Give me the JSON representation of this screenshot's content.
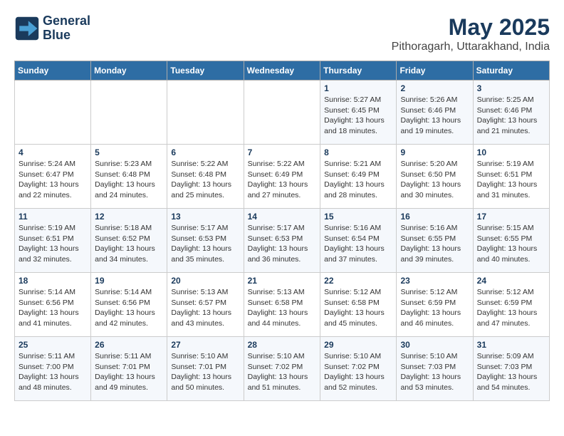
{
  "header": {
    "logo_line1": "General",
    "logo_line2": "Blue",
    "month_year": "May 2025",
    "location": "Pithoragarh, Uttarakhand, India"
  },
  "weekdays": [
    "Sunday",
    "Monday",
    "Tuesday",
    "Wednesday",
    "Thursday",
    "Friday",
    "Saturday"
  ],
  "weeks": [
    [
      {
        "day": "",
        "info": ""
      },
      {
        "day": "",
        "info": ""
      },
      {
        "day": "",
        "info": ""
      },
      {
        "day": "",
        "info": ""
      },
      {
        "day": "1",
        "info": "Sunrise: 5:27 AM\nSunset: 6:45 PM\nDaylight: 13 hours\nand 18 minutes."
      },
      {
        "day": "2",
        "info": "Sunrise: 5:26 AM\nSunset: 6:46 PM\nDaylight: 13 hours\nand 19 minutes."
      },
      {
        "day": "3",
        "info": "Sunrise: 5:25 AM\nSunset: 6:46 PM\nDaylight: 13 hours\nand 21 minutes."
      }
    ],
    [
      {
        "day": "4",
        "info": "Sunrise: 5:24 AM\nSunset: 6:47 PM\nDaylight: 13 hours\nand 22 minutes."
      },
      {
        "day": "5",
        "info": "Sunrise: 5:23 AM\nSunset: 6:48 PM\nDaylight: 13 hours\nand 24 minutes."
      },
      {
        "day": "6",
        "info": "Sunrise: 5:22 AM\nSunset: 6:48 PM\nDaylight: 13 hours\nand 25 minutes."
      },
      {
        "day": "7",
        "info": "Sunrise: 5:22 AM\nSunset: 6:49 PM\nDaylight: 13 hours\nand 27 minutes."
      },
      {
        "day": "8",
        "info": "Sunrise: 5:21 AM\nSunset: 6:49 PM\nDaylight: 13 hours\nand 28 minutes."
      },
      {
        "day": "9",
        "info": "Sunrise: 5:20 AM\nSunset: 6:50 PM\nDaylight: 13 hours\nand 30 minutes."
      },
      {
        "day": "10",
        "info": "Sunrise: 5:19 AM\nSunset: 6:51 PM\nDaylight: 13 hours\nand 31 minutes."
      }
    ],
    [
      {
        "day": "11",
        "info": "Sunrise: 5:19 AM\nSunset: 6:51 PM\nDaylight: 13 hours\nand 32 minutes."
      },
      {
        "day": "12",
        "info": "Sunrise: 5:18 AM\nSunset: 6:52 PM\nDaylight: 13 hours\nand 34 minutes."
      },
      {
        "day": "13",
        "info": "Sunrise: 5:17 AM\nSunset: 6:53 PM\nDaylight: 13 hours\nand 35 minutes."
      },
      {
        "day": "14",
        "info": "Sunrise: 5:17 AM\nSunset: 6:53 PM\nDaylight: 13 hours\nand 36 minutes."
      },
      {
        "day": "15",
        "info": "Sunrise: 5:16 AM\nSunset: 6:54 PM\nDaylight: 13 hours\nand 37 minutes."
      },
      {
        "day": "16",
        "info": "Sunrise: 5:16 AM\nSunset: 6:55 PM\nDaylight: 13 hours\nand 39 minutes."
      },
      {
        "day": "17",
        "info": "Sunrise: 5:15 AM\nSunset: 6:55 PM\nDaylight: 13 hours\nand 40 minutes."
      }
    ],
    [
      {
        "day": "18",
        "info": "Sunrise: 5:14 AM\nSunset: 6:56 PM\nDaylight: 13 hours\nand 41 minutes."
      },
      {
        "day": "19",
        "info": "Sunrise: 5:14 AM\nSunset: 6:56 PM\nDaylight: 13 hours\nand 42 minutes."
      },
      {
        "day": "20",
        "info": "Sunrise: 5:13 AM\nSunset: 6:57 PM\nDaylight: 13 hours\nand 43 minutes."
      },
      {
        "day": "21",
        "info": "Sunrise: 5:13 AM\nSunset: 6:58 PM\nDaylight: 13 hours\nand 44 minutes."
      },
      {
        "day": "22",
        "info": "Sunrise: 5:12 AM\nSunset: 6:58 PM\nDaylight: 13 hours\nand 45 minutes."
      },
      {
        "day": "23",
        "info": "Sunrise: 5:12 AM\nSunset: 6:59 PM\nDaylight: 13 hours\nand 46 minutes."
      },
      {
        "day": "24",
        "info": "Sunrise: 5:12 AM\nSunset: 6:59 PM\nDaylight: 13 hours\nand 47 minutes."
      }
    ],
    [
      {
        "day": "25",
        "info": "Sunrise: 5:11 AM\nSunset: 7:00 PM\nDaylight: 13 hours\nand 48 minutes."
      },
      {
        "day": "26",
        "info": "Sunrise: 5:11 AM\nSunset: 7:01 PM\nDaylight: 13 hours\nand 49 minutes."
      },
      {
        "day": "27",
        "info": "Sunrise: 5:10 AM\nSunset: 7:01 PM\nDaylight: 13 hours\nand 50 minutes."
      },
      {
        "day": "28",
        "info": "Sunrise: 5:10 AM\nSunset: 7:02 PM\nDaylight: 13 hours\nand 51 minutes."
      },
      {
        "day": "29",
        "info": "Sunrise: 5:10 AM\nSunset: 7:02 PM\nDaylight: 13 hours\nand 52 minutes."
      },
      {
        "day": "30",
        "info": "Sunrise: 5:10 AM\nSunset: 7:03 PM\nDaylight: 13 hours\nand 53 minutes."
      },
      {
        "day": "31",
        "info": "Sunrise: 5:09 AM\nSunset: 7:03 PM\nDaylight: 13 hours\nand 54 minutes."
      }
    ]
  ]
}
